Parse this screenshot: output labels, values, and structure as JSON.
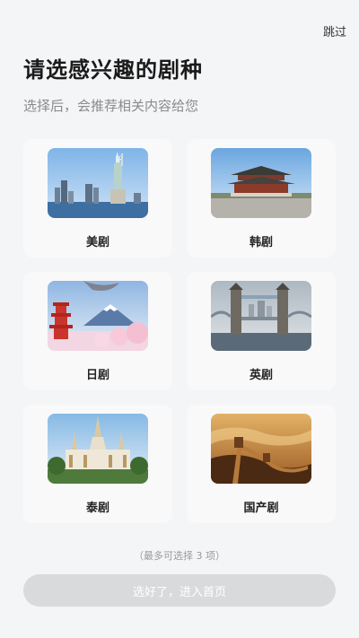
{
  "header": {
    "skip_label": "跳过",
    "title": "请选感兴趣的剧种",
    "subtitle": "选择后，会推荐相关内容给您"
  },
  "genres": [
    {
      "label": "美剧",
      "icon": "statue-of-liberty-image"
    },
    {
      "label": "韩剧",
      "icon": "korean-palace-image"
    },
    {
      "label": "日剧",
      "icon": "mount-fuji-pagoda-image"
    },
    {
      "label": "英剧",
      "icon": "tower-bridge-image"
    },
    {
      "label": "泰剧",
      "icon": "thai-temple-image"
    },
    {
      "label": "国产剧",
      "icon": "great-wall-image"
    }
  ],
  "footer": {
    "hint": "（最多可选择 3 项）",
    "confirm_label": "选好了，进入首页"
  }
}
